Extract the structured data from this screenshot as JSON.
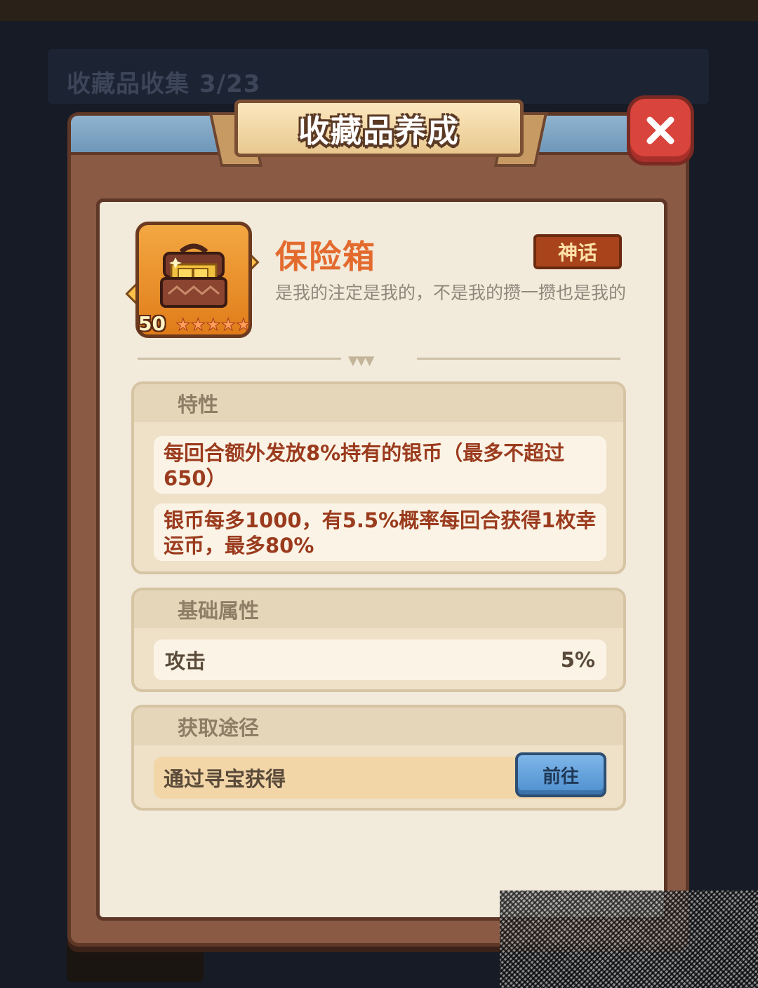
{
  "background": {
    "collection_label": "收藏品收集",
    "collection_count": "3/23"
  },
  "dialog": {
    "title": "收藏品养成",
    "close_icon": "close-icon"
  },
  "item": {
    "name": "保险箱",
    "rarity": "神话",
    "description": "是我的注定是我的，不是我的攒一攒也是我的",
    "level": "50",
    "stars": 5,
    "icon": "treasure-chest-icon"
  },
  "traits": {
    "title": "特性",
    "items": [
      "每回合额外发放8%持有的银币（最多不超过650）",
      "银币每多1000，有5.5%概率每回合获得1枚幸运币，最多80%"
    ]
  },
  "base_attributes": {
    "title": "基础属性",
    "rows": [
      {
        "label": "攻击",
        "value": "5%"
      }
    ]
  },
  "acquisition": {
    "title": "获取途径",
    "method": "通过寻宝获得",
    "go_label": "前往"
  },
  "colors": {
    "item_name": "#e36a2d",
    "trait_text": "#9b3b1e",
    "go_button": "#5b9ad8",
    "close_button": "#d9443c"
  }
}
